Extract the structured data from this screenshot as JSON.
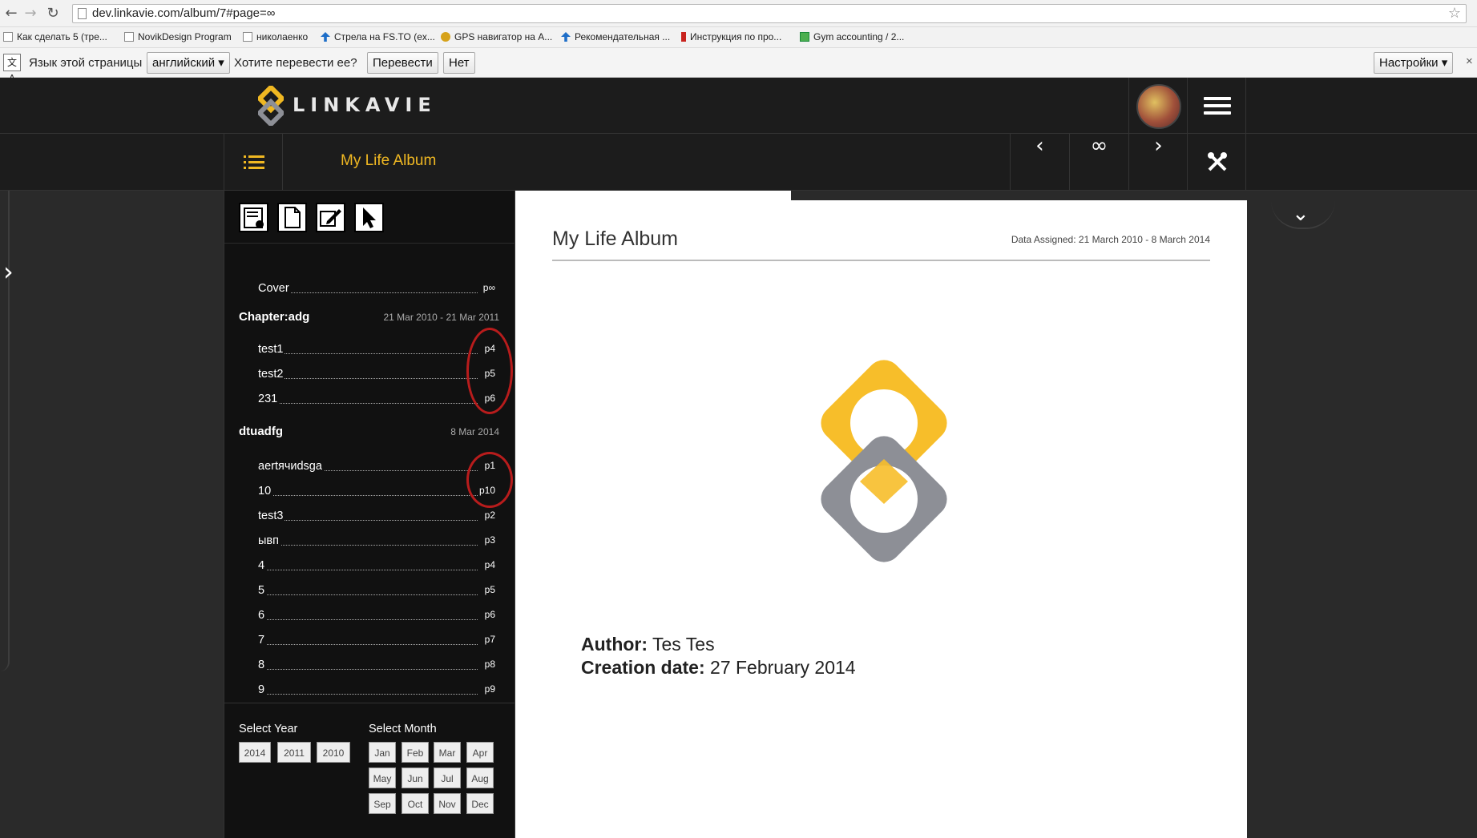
{
  "browser": {
    "url": "dev.linkavie.com/album/7#page=∞",
    "bookmarks": [
      "Как сделать 5 (тре...",
      "NovikDesign Program",
      "николаенко",
      "Стрела на FS.TO (ex...",
      "GPS навигатор на А...",
      "Рекомендательная ...",
      "Инструкция по про...",
      "Gym accounting / 2..."
    ],
    "translate": {
      "page_language_label": "Язык этой страницы",
      "language": "английский ▾",
      "question": "Хотите перевести ее?",
      "translate_button": "Перевести",
      "no_button": "Нет",
      "settings_button": "Настройки ▾",
      "close": "×"
    }
  },
  "header": {
    "logo_text": "LINKAVIE"
  },
  "subheader": {
    "title": "My Life Album",
    "prev": "‹",
    "infinity": "∞",
    "next": "›"
  },
  "toc": {
    "cover": {
      "label": "Cover",
      "page": "p∞"
    },
    "chapters": [
      {
        "name": "Chapter:adg",
        "dates": "21 Mar 2010 - 21 Mar 2011",
        "items": [
          {
            "label": "test1",
            "page": "p4"
          },
          {
            "label": "test2",
            "page": "p5"
          },
          {
            "label": "231",
            "page": "p6"
          }
        ]
      },
      {
        "name": "dtuadfg",
        "dates": "8 Mar 2014",
        "items": [
          {
            "label": "aertячиdsga",
            "page": "p1"
          },
          {
            "label": "10",
            "page": "p10"
          },
          {
            "label": "test3",
            "page": "p2"
          },
          {
            "label": "ывп",
            "page": "p3"
          },
          {
            "label": "4",
            "page": "p4"
          },
          {
            "label": "5",
            "page": "p5"
          },
          {
            "label": "6",
            "page": "p6"
          },
          {
            "label": "7",
            "page": "p7"
          },
          {
            "label": "8",
            "page": "p8"
          },
          {
            "label": "9",
            "page": "p9"
          }
        ]
      }
    ]
  },
  "filters": {
    "year_label": "Select Year",
    "month_label": "Select Month",
    "years": [
      "2014",
      "2011",
      "2010"
    ],
    "months": [
      "Jan",
      "Feb",
      "Mar",
      "Apr",
      "May",
      "Jun",
      "Jul",
      "Aug",
      "Sep",
      "Oct",
      "Nov",
      "Dec"
    ]
  },
  "page": {
    "title": "My Life Album",
    "assigned": "Data Assigned: 21 March 2010 - 8 March 2014",
    "author_label": "Author:",
    "author": "Tes Tes",
    "creation_label": "Creation date:",
    "creation_date": "27 February 2014"
  },
  "colors": {
    "accent": "#f0b822",
    "logo_gray": "#8d8f96",
    "highlight_circle": "#b81c1c"
  }
}
